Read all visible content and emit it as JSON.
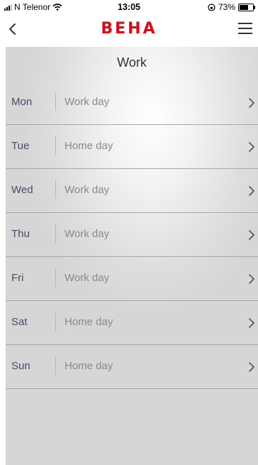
{
  "status_bar": {
    "carrier": "N Telenor",
    "time": "13:05",
    "battery": "73%",
    "battery_level": 0.73
  },
  "nav": {
    "logo": "BEHA"
  },
  "page": {
    "title": "Work"
  },
  "days": [
    {
      "day": "Mon",
      "type": "Work day"
    },
    {
      "day": "Tue",
      "type": "Home day"
    },
    {
      "day": "Wed",
      "type": "Work day"
    },
    {
      "day": "Thu",
      "type": "Work day"
    },
    {
      "day": "Fri",
      "type": "Work day"
    },
    {
      "day": "Sat",
      "type": "Home day"
    },
    {
      "day": "Sun",
      "type": "Home day"
    }
  ],
  "icons": {
    "back": "chevron-left-icon",
    "menu": "hamburger-menu-icon",
    "row": "chevron-right-icon"
  },
  "colors": {
    "brand": "#e30613",
    "day_text": "#4a4a6a",
    "type_text": "#8a8a8a"
  }
}
